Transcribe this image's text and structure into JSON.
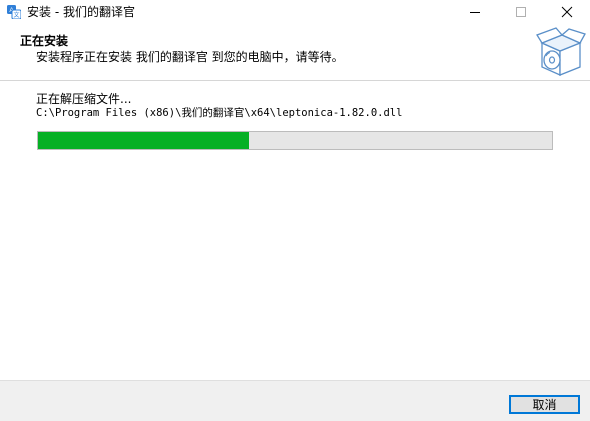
{
  "window": {
    "title": "安装 - 我们的翻译官",
    "icon": "translate-app-icon",
    "controls": [
      "minimize-icon",
      "maximize-icon",
      "close-icon"
    ]
  },
  "header": {
    "title": "正在安装",
    "subtitle": "安装程序正在安装 我们的翻译官 到您的电脑中，请等待。",
    "icon": "installer-box-icon"
  },
  "main": {
    "status": "正在解压缩文件...",
    "file_path": "C:\\Program Files (x86)\\我们的翻译官\\x64\\leptonica-1.82.0.dll",
    "progress_fraction": 0.41,
    "progress_color": "#06b025"
  },
  "footer": {
    "cancel_label": "取消"
  }
}
